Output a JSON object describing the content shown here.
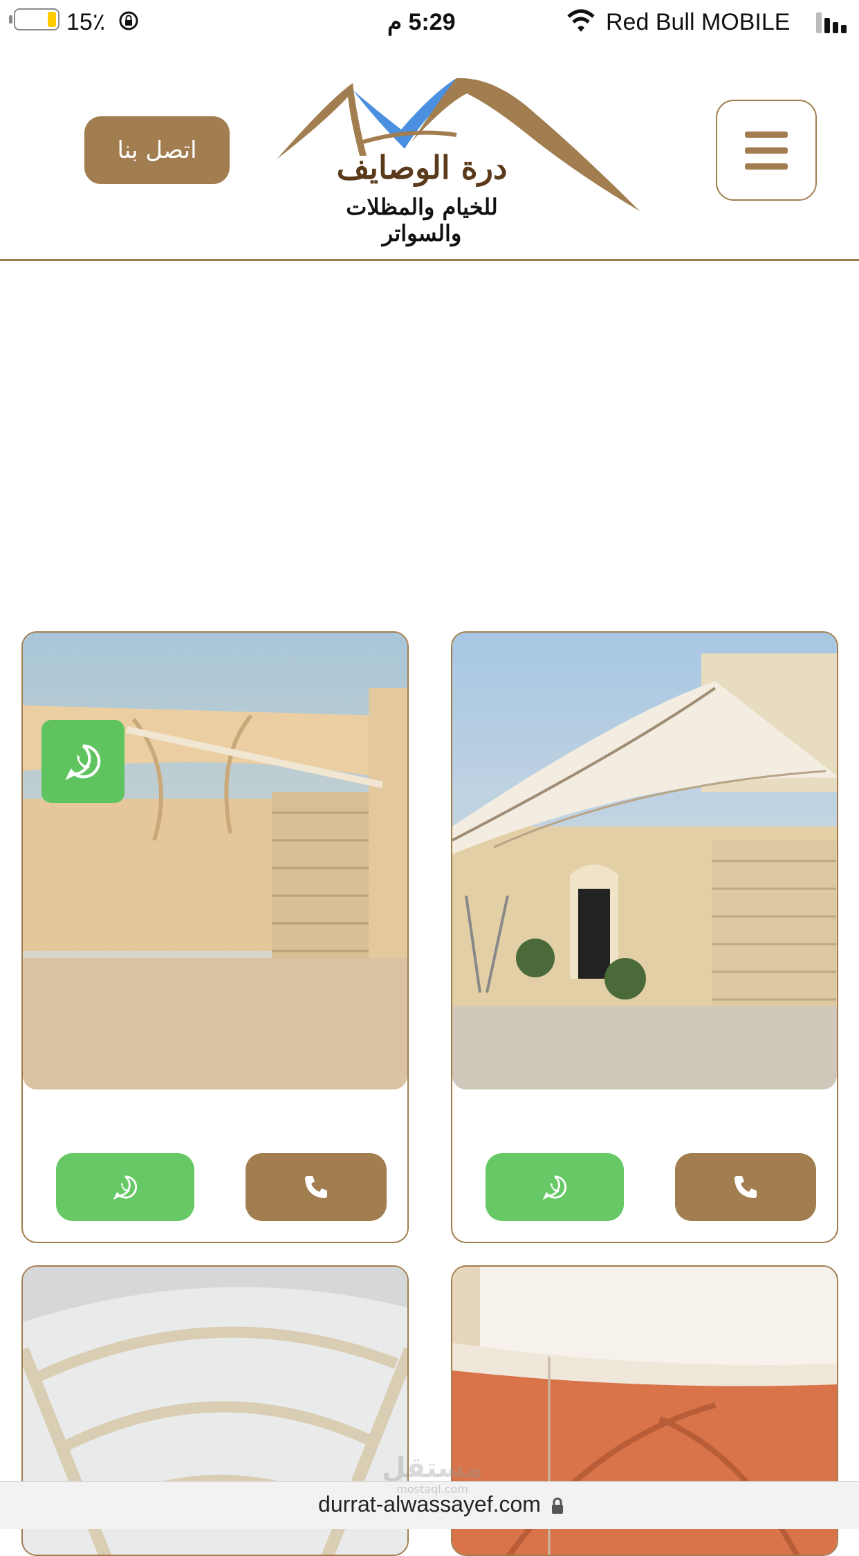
{
  "status_bar": {
    "battery": "15٪",
    "time": "5:29 م",
    "carrier": "Red Bull MOBILE"
  },
  "header": {
    "contact_label": "اتصل بنا",
    "logo_title": "درة الوصايف",
    "logo_subtitle": "للخيام والمظلات والسواتر"
  },
  "colors": {
    "brand_brown": "#a17d4f",
    "whatsapp_green": "#67c966",
    "logo_blue": "#4a8fe0"
  },
  "cards": [
    {
      "photo": "shade-canopy-house-garage"
    },
    {
      "photo": "shade-canopy-beige-yard"
    },
    {
      "photo": "shade-canopy-orange"
    },
    {
      "photo": "shade-canopy-white-arches"
    }
  ],
  "watermark": {
    "text": "مستقل",
    "sub": "mostaql.com"
  },
  "url_bar": {
    "url": "durrat-alwassayef.com"
  }
}
